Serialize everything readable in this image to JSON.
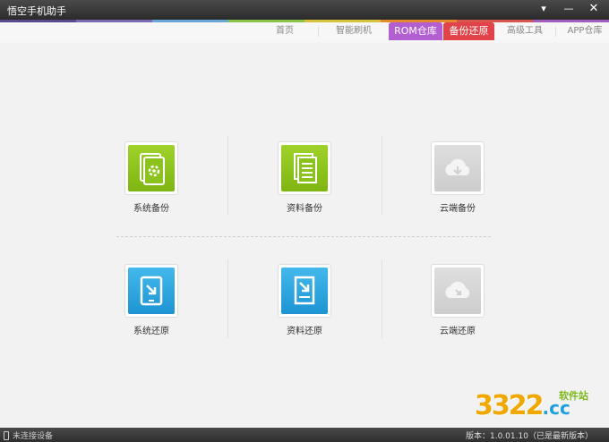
{
  "window": {
    "title": "悟空手机助手"
  },
  "titlebar": {
    "menu_glyph": "▾",
    "min_glyph": "—",
    "close_glyph": "✕"
  },
  "stripe_colors": [
    "#5b4a8f",
    "#7c6bb2",
    "#69a8d6",
    "#8bc34a",
    "#d9c23b",
    "#e58a2f",
    "#d9534f",
    "#a05fbf"
  ],
  "nav": {
    "tabs": [
      {
        "label": "首页"
      },
      {
        "label": "智能刷机"
      },
      {
        "label": "ROM仓库",
        "active": true,
        "color": "#b35fd1"
      },
      {
        "label": "备份还原",
        "active": true,
        "color": "#e2434b"
      },
      {
        "label": "高级工具"
      },
      {
        "label": "APP仓库"
      }
    ]
  },
  "backup": {
    "system": {
      "label": "系统备份",
      "icon": "tablet-gear-icon"
    },
    "data": {
      "label": "资料备份",
      "icon": "documents-icon"
    },
    "cloud": {
      "label": "云端备份",
      "icon": "cloud-icon"
    }
  },
  "restore": {
    "system": {
      "label": "系统还原",
      "icon": "tablet-arrow-icon"
    },
    "data": {
      "label": "资料还原",
      "icon": "document-arrow-icon"
    },
    "cloud": {
      "label": "云端还原",
      "icon": "cloud-icon"
    }
  },
  "status": {
    "connection": "未连接设备",
    "version": "版本：1.0.01.10（已是最新版本）"
  },
  "watermark": {
    "number": "3322",
    "domain": ".cc",
    "site": "软件站"
  }
}
